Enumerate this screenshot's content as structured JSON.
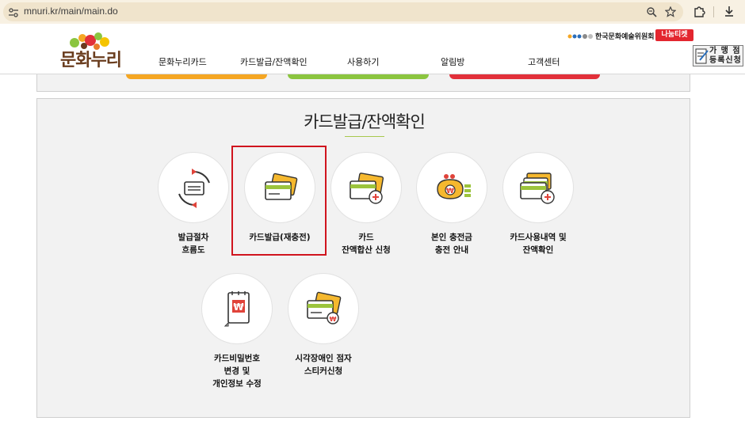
{
  "browser": {
    "url": "mnuri.kr/main/main.do",
    "icons": [
      "site-settings-icon",
      "zoom-icon",
      "star-icon",
      "extensions-icon",
      "download-icon"
    ]
  },
  "header": {
    "logo_text": "문화누리",
    "nav": [
      "문화누리카드",
      "카드발급/잔액확인",
      "사용하기",
      "알림방",
      "고객센터"
    ],
    "org_name": "한국문화예술위원회",
    "ticket_badge": "나눔티켓",
    "merchant_badge": "가 맹 점\n등록신청"
  },
  "colors": {
    "accent_green": "#a8c84e",
    "highlight_red": "#d0141e",
    "card_yellow": "#f5b82e",
    "card_green": "#9cc43c",
    "icon_red": "#e0433a",
    "pill_orange": "#f5a623",
    "pill_green": "#8bc53f",
    "pill_red": "#e2303a"
  },
  "section": {
    "title": "카드발급/잔액확인",
    "items": [
      {
        "label": "발급절차\n흐름도",
        "icon": "process-cycle-icon"
      },
      {
        "label": "카드발급(재충전)",
        "icon": "card-issue-icon"
      },
      {
        "label": "카드\n잔액합산 신청",
        "icon": "card-balance-add-icon"
      },
      {
        "label": "본인 충전금\n충전 안내",
        "icon": "wallet-won-icon"
      },
      {
        "label": "카드사용내역 및\n잔액확인",
        "icon": "card-history-icon"
      },
      {
        "label": "카드비밀번호\n변경 및\n개인정보 수정",
        "icon": "won-notepad-icon"
      },
      {
        "label": "시각장애인 점자\n스티커신청",
        "icon": "braille-card-icon"
      }
    ]
  }
}
